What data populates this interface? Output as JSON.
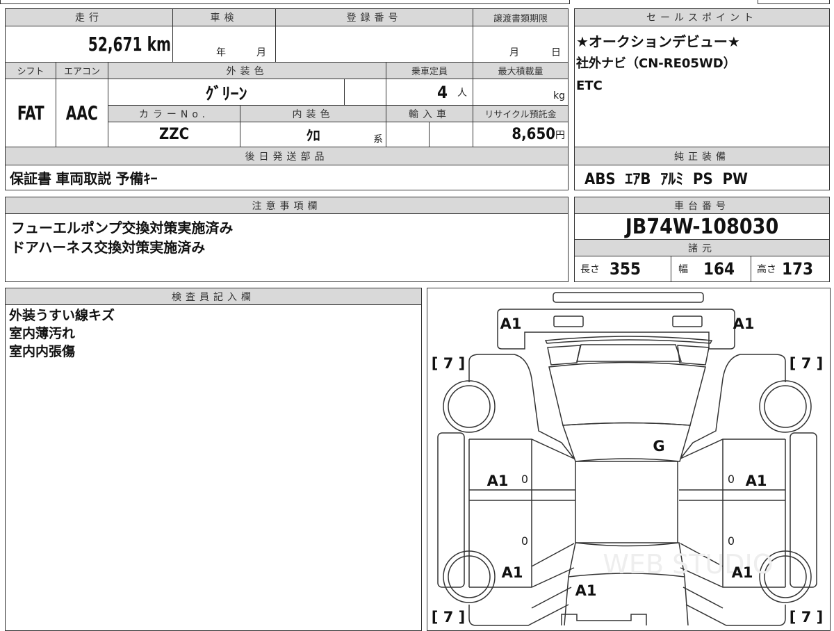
{
  "sheet": {
    "mileage": {
      "label": "走行",
      "value": "52,671 km"
    },
    "inspection": {
      "label": "車検",
      "year_unit": "年",
      "month_unit": "月"
    },
    "registration": {
      "label": "登録番号"
    },
    "transfer_deadline": {
      "label": "譲渡書類期限",
      "month_unit": "月",
      "day_unit": "日"
    },
    "shift": {
      "label": "シフト",
      "value": "FAT"
    },
    "aircon": {
      "label": "エアコン",
      "value": "AAC"
    },
    "exterior_color": {
      "label": "外装色",
      "value": "ｸﾞﾘｰﾝ"
    },
    "capacity": {
      "label": "乗車定員",
      "value": "4",
      "unit": "人"
    },
    "max_load": {
      "label": "最大積載量",
      "unit": "kg"
    },
    "color_no": {
      "label": "カラーNo.",
      "value": "ZZC"
    },
    "interior_color": {
      "label": "内装色",
      "value": "ｸﾛ",
      "unit": "系"
    },
    "import": {
      "label": "輸入車"
    },
    "recycle": {
      "label": "リサイクル預託金",
      "value": "8,650",
      "unit": "円"
    },
    "later_parts": {
      "label": "後日発送部品",
      "value": "保証書 車両取説 予備ｷｰ"
    },
    "notes": {
      "label": "注意事項欄",
      "lines": [
        "フューエルポンプ交換対策実施済み",
        "ドアハーネス交換対策実施済み"
      ]
    },
    "inspector": {
      "label": "検査員記入欄",
      "lines": [
        "外装うすい線キズ",
        "室内薄汚れ",
        "室内内張傷"
      ]
    }
  },
  "right": {
    "sales_point": {
      "label": "セールスポイント",
      "lines": [
        "★オークションデビュー★",
        "社外ナビ（CN-RE05WD）",
        "ETC"
      ]
    },
    "equipment": {
      "label": "純正装備",
      "value": "ABS  ｴｱB  ｱﾙﾐ  PS  PW"
    },
    "chassis": {
      "label": "車台番号",
      "value": "JB74W-108030"
    },
    "specs": {
      "label": "諸元",
      "length_label": "長さ",
      "length": "355",
      "width_label": "幅",
      "width": "164",
      "height_label": "高さ",
      "height": "173"
    }
  },
  "diagram": {
    "marks": {
      "front_left": "A1",
      "front_right": "A1",
      "roof_front": "G",
      "left_front_door": "A1",
      "right_front_door": "A1",
      "left_rear": "A1",
      "right_rear": "A1",
      "rear": "A1",
      "door_small": "0"
    },
    "tire_tread": "[ 7 ]",
    "watermark": "WEB STUDIO"
  }
}
